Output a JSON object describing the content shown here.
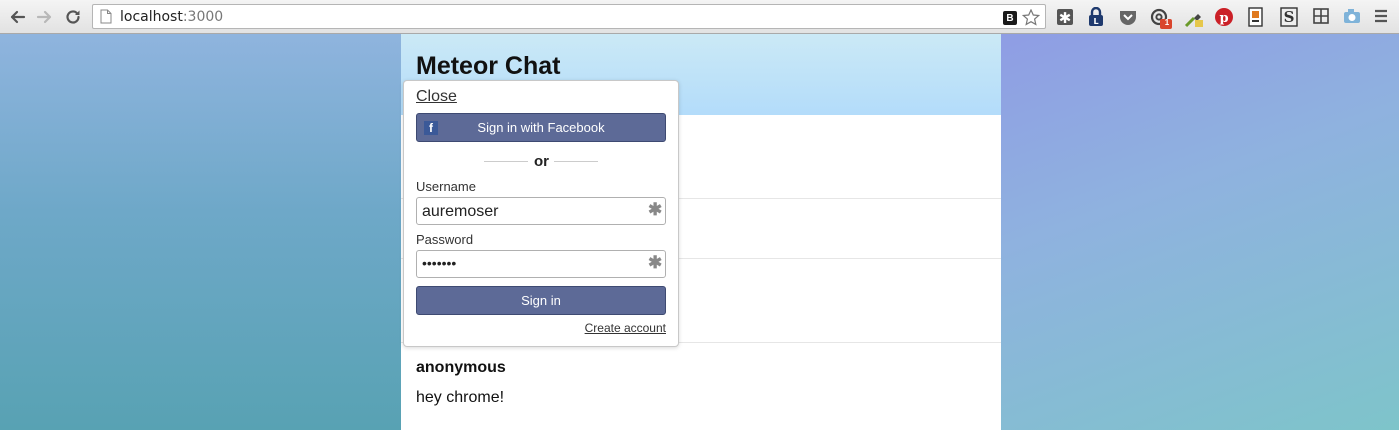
{
  "browser": {
    "url_host": "localhost",
    "url_port": ":3000",
    "bookmark_ext_letter": "B",
    "icons": [
      "back-icon",
      "forward-icon",
      "reload-icon",
      "page-icon",
      "star-icon"
    ],
    "extensions": [
      "asterisk-ext-icon",
      "lock-ext-icon",
      "pocket-ext-icon",
      "mail-ext-icon",
      "dropper-ext-icon",
      "pinterest-ext-icon",
      "bookmark-ext-icon",
      "s-ext-icon",
      "grid-ext-icon",
      "camera-ext-icon",
      "menu-icon"
    ],
    "mail_badge": "1",
    "s_ext_letter": "S"
  },
  "app": {
    "title": "Meteor Chat"
  },
  "login": {
    "close_label": "Close",
    "facebook_icon": "f",
    "facebook_label": "Sign in with Facebook",
    "or_label": "or",
    "username_label": "Username",
    "username_value": "auremoser",
    "password_label": "Password",
    "password_value": "•••••••",
    "field_required_mark": "✱",
    "signin_label": "Sign in",
    "create_account_label": "Create account"
  },
  "messages": [
    {
      "author": "anonymous",
      "text": "hey chrome!"
    }
  ],
  "colors": {
    "header_gradient_top": "#cbe9f6",
    "header_gradient_bottom": "#b3dcfa",
    "button": "#5d6a97",
    "facebook": "#3b5998"
  }
}
